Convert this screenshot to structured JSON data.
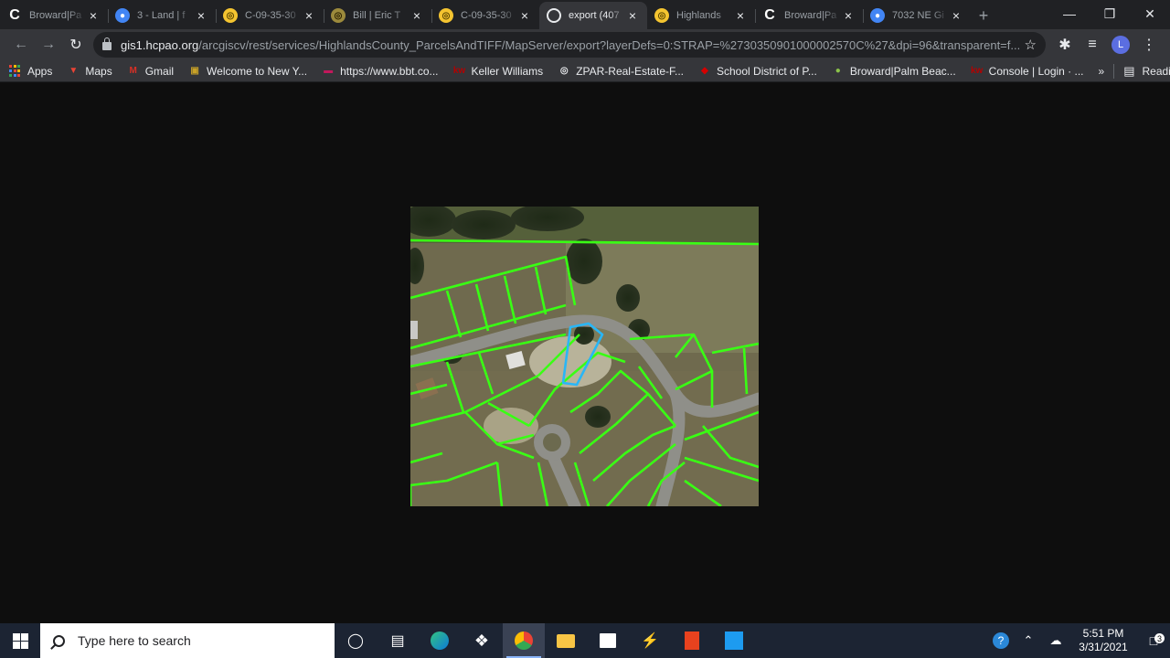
{
  "tabs": [
    {
      "title": "Broward|Pa",
      "favicon": "c-logo-icon",
      "active": false
    },
    {
      "title": "3 - Land | f",
      "favicon": "blue-dot-icon",
      "active": false
    },
    {
      "title": "C-09-35-30",
      "favicon": "yellow-badge-icon",
      "active": false
    },
    {
      "title": "Bill | Eric T",
      "favicon": "olive-badge-icon",
      "active": false
    },
    {
      "title": "C-09-35-30",
      "favicon": "yellow-badge-icon",
      "active": false
    },
    {
      "title": "export (407",
      "favicon": "globe-icon",
      "active": true
    },
    {
      "title": "Highlands",
      "favicon": "yellow-badge-icon",
      "active": false
    },
    {
      "title": "Broward|Pa",
      "favicon": "c-logo-icon",
      "active": false
    },
    {
      "title": "7032 NE Gi",
      "favicon": "blue-dot-icon",
      "active": false
    }
  ],
  "address": {
    "host": "gis1.hcpao.org",
    "path": "/arcgiscv/rest/services/HighlandsCounty_ParcelsAndTIFF/MapServer/export?layerDefs=0:STRAP=%2730350901000002570C%27&dpi=96&transparent=f..."
  },
  "profile_initial": "L",
  "bookmarks": [
    {
      "label": "Apps",
      "icon": "apps-grid-icon"
    },
    {
      "label": "Maps",
      "icon": "maps-pin-icon"
    },
    {
      "label": "Gmail",
      "icon": "gmail-icon"
    },
    {
      "label": "Welcome to New Y...",
      "icon": "newyork-icon"
    },
    {
      "label": "https://www.bbt.co...",
      "icon": "bbt-icon"
    },
    {
      "label": "Keller Williams",
      "icon": "kw-icon"
    },
    {
      "label": "ZPAR-Real-Estate-F...",
      "icon": "globe-icon"
    },
    {
      "label": "School District of P...",
      "icon": "school-icon"
    },
    {
      "label": "Broward|Palm Beac...",
      "icon": "leaf-icon"
    },
    {
      "label": "Console | Login · ...",
      "icon": "kw-icon"
    }
  ],
  "bookmarks_more": "»",
  "reading_list": "Reading list",
  "taskbar": {
    "search_placeholder": "Type here to search",
    "time": "5:51 PM",
    "date": "3/31/2021",
    "notification_count": "3"
  }
}
